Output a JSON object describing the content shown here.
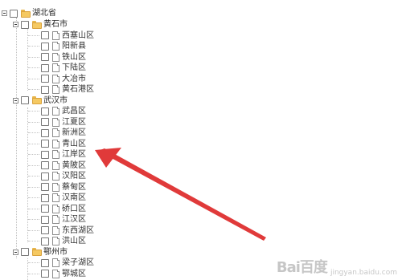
{
  "tree": {
    "root": {
      "label": "湖北省",
      "icon": "folder-icon"
    },
    "groups": [
      {
        "label": "黄石市",
        "icon": "folder-icon",
        "children": [
          "西塞山区",
          "阳新县",
          "铁山区",
          "下陆区",
          "大冶市",
          "黄石港区"
        ]
      },
      {
        "label": "武汉市",
        "icon": "folder-icon",
        "children": [
          "武昌区",
          "江夏区",
          "新洲区",
          "青山区",
          "江岸区",
          "黄陂区",
          "汉阳区",
          "蔡甸区",
          "汉南区",
          "硚口区",
          "江汉区",
          "东西湖区",
          "洪山区"
        ]
      },
      {
        "label": "鄂州市",
        "icon": "folder-icon",
        "children": [
          "梁子湖区",
          "鄂城区"
        ]
      }
    ]
  },
  "annotation": {
    "type": "red-arrow",
    "color": "#e03a3a"
  },
  "watermark": {
    "mark": "Bai百度",
    "url": "jingyan.baidu.com"
  },
  "colors": {
    "folder": "#f5c962",
    "arrow": "#e03a3a",
    "guide": "#c0c0c0"
  }
}
